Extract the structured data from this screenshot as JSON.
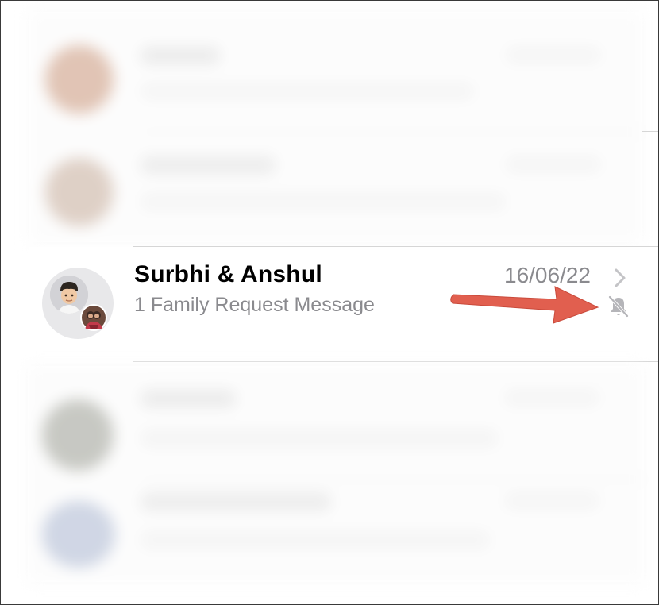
{
  "conversation": {
    "title": "Surbhi & Anshul",
    "subtitle": "1 Family Request Message",
    "date": "16/06/22",
    "avatar_main": "memoji-avatar",
    "avatar_secondary": "group-member-avatar",
    "chevron_icon": "chevron-right-icon",
    "mute_icon": "bell-slash-icon",
    "muted": true
  },
  "annotation": {
    "arrow_color": "#e15f4f",
    "target": "bell-slash-icon"
  },
  "colors": {
    "secondary_text": "#8a8a8e",
    "separator": "#d6d6d6",
    "avatar_background": "#e8e8ea"
  }
}
